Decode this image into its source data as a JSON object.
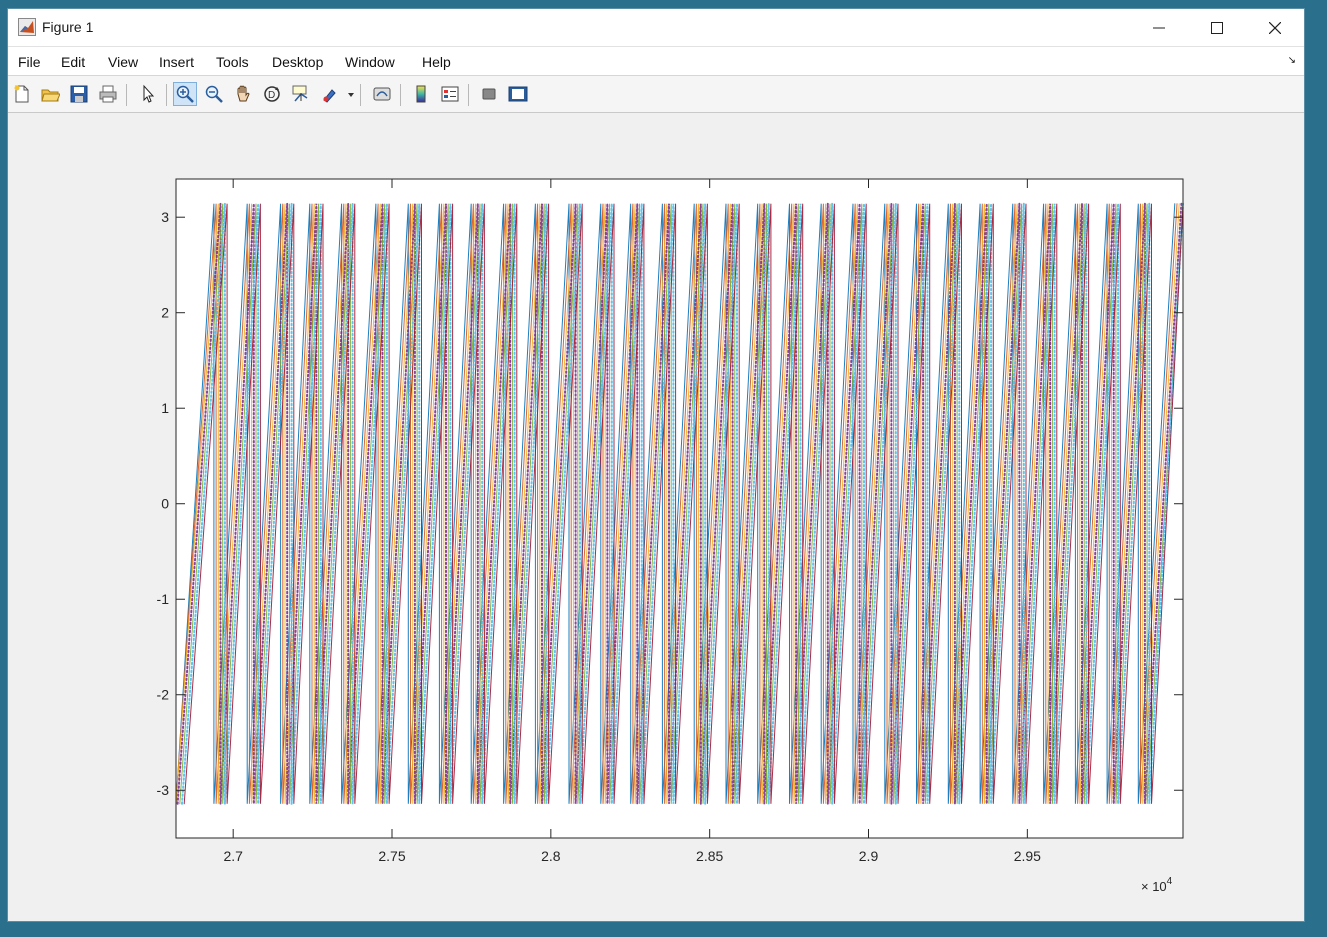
{
  "window": {
    "title": "Figure 1",
    "controls": {
      "minimize": "minimize",
      "maximize": "maximize",
      "close": "close"
    }
  },
  "menubar": {
    "items": [
      "File",
      "Edit",
      "View",
      "Insert",
      "Tools",
      "Desktop",
      "Window",
      "Help"
    ]
  },
  "toolbar": {
    "buttons": [
      {
        "icon": "new-figure-icon"
      },
      {
        "icon": "open-file-icon"
      },
      {
        "icon": "save-icon"
      },
      {
        "icon": "print-icon"
      },
      {
        "icon": "pointer-icon"
      },
      {
        "icon": "zoom-in-icon",
        "active": true
      },
      {
        "icon": "zoom-out-icon"
      },
      {
        "icon": "pan-icon"
      },
      {
        "icon": "rotate-3d-icon"
      },
      {
        "icon": "data-cursor-icon"
      },
      {
        "icon": "brush-icon"
      },
      {
        "icon": "link-plot-icon"
      },
      {
        "icon": "colorbar-icon"
      },
      {
        "icon": "legend-icon"
      },
      {
        "icon": "hide-plot-tools-icon"
      },
      {
        "icon": "show-plot-tools-icon"
      }
    ]
  },
  "chart_data": {
    "type": "line",
    "title": "",
    "xlabel": "",
    "ylabel": "",
    "x_exponent_label": "× 10^4",
    "xlim": [
      26820,
      29990
    ],
    "ylim": [
      -3.5,
      3.4
    ],
    "xticks": [
      27000,
      27500,
      28000,
      28500,
      29000,
      29500
    ],
    "xtick_labels": [
      "2.7",
      "2.75",
      "2.8",
      "2.85",
      "2.9",
      "2.95"
    ],
    "yticks": [
      3,
      2,
      1,
      0,
      -1,
      -2,
      -3
    ],
    "ytick_labels": [
      "3",
      "2",
      "1",
      "0",
      "-1",
      "-2",
      "-3"
    ],
    "grid": false,
    "legend": "none",
    "series_colors": [
      "#0072bd",
      "#d95319",
      "#edb120",
      "#7e2f8e",
      "#77ac30",
      "#4dbeee",
      "#a2142f"
    ],
    "wrap_x": [
      26825,
      26960,
      27065,
      27170,
      27262,
      27362,
      27470,
      27572,
      27670,
      27770,
      27872,
      27972,
      28078,
      28178,
      28272,
      28372,
      28472,
      28572,
      28672,
      28772,
      28872,
      28972,
      29072,
      29172,
      29272,
      29372,
      29475,
      29572,
      29672,
      29772,
      29870,
      29985
    ],
    "y_range_wrapped": [
      -3.14159,
      3.14159
    ],
    "description_values": {
      "y_min": -3.14,
      "y_max": 3.14
    }
  }
}
